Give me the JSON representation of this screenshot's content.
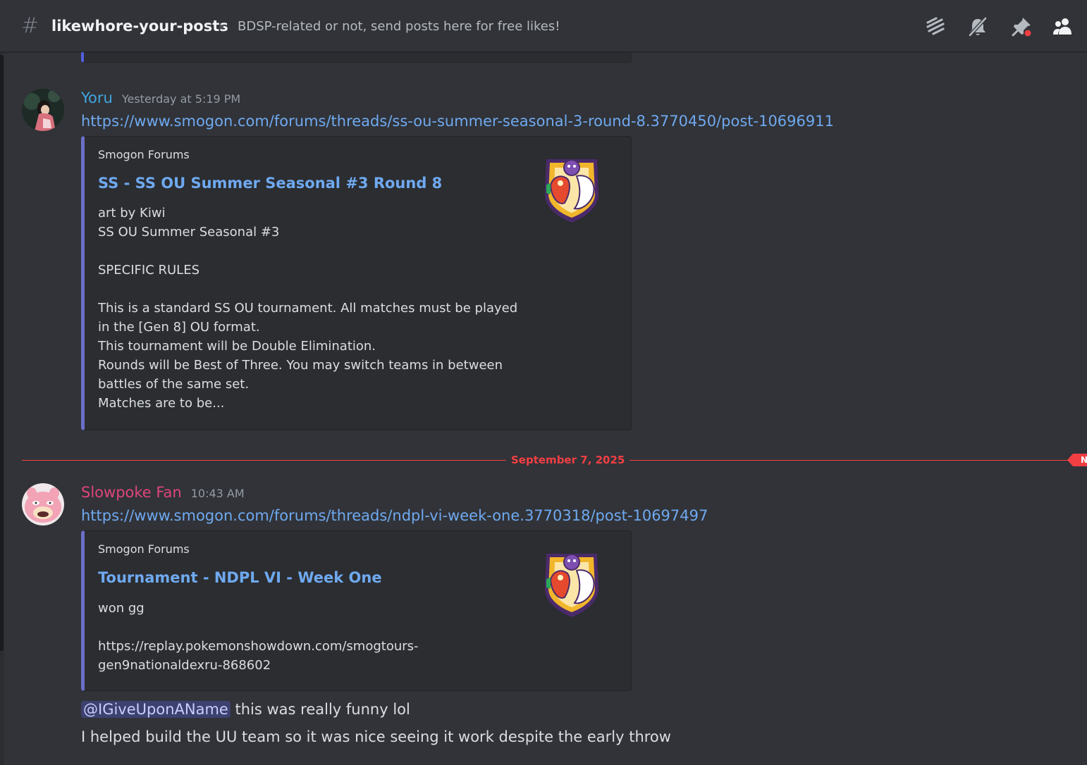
{
  "header": {
    "channel_name": "likewhore-your-posts",
    "topic": "BDSP-related or not, send posts here for free likes!",
    "icons": [
      "threads-icon",
      "notification-muted-icon",
      "pinned-messages-icon",
      "member-list-icon"
    ]
  },
  "messages": [
    {
      "author": "Yoru",
      "author_color": "#3fa7e0",
      "timestamp": "Yesterday at 5:19 PM",
      "link": "https://www.smogon.com/forums/threads/ss-ou-summer-seasonal-3-round-8.3770450/post-10696911",
      "embed": {
        "provider": "Smogon Forums",
        "title": "SS - SS OU Summer Seasonal #3 Round 8",
        "description": "art by Kiwi\nSS OU Summer Seasonal #3\n\nSPECIFIC RULES\n\nThis is a standard SS OU tournament. All matches must be played\nin the [Gen 8] OU format.\nThis tournament will be Double Elimination.\nRounds will be Best of Three. You may switch teams in between\nbattles of the same set.\nMatches are to be..."
      }
    },
    {
      "author": "Slowpoke Fan",
      "author_color": "#e0457b",
      "timestamp": "10:43 AM",
      "link": "https://www.smogon.com/forums/threads/ndpl-vi-week-one.3770318/post-10697497",
      "embed": {
        "provider": "Smogon Forums",
        "title": "Tournament - NDPL VI - Week One",
        "description": "won gg\n\nhttps://replay.pokemonshowdown.com/smogtours-\ngen9nationaldexru-868602"
      },
      "mention": "@IGiveUponAName",
      "text_after_mention": " this was really funny lol",
      "text_line2": "I helped build the UU team so it was nice seeing it work despite the early throw"
    }
  ],
  "date_divider": {
    "label": "September 7, 2025",
    "badge": "NE"
  },
  "colors": {
    "background": "#313338",
    "embed_bg": "#2b2d31",
    "link": "#6fa9f0",
    "new_divider": "#f23f43"
  }
}
